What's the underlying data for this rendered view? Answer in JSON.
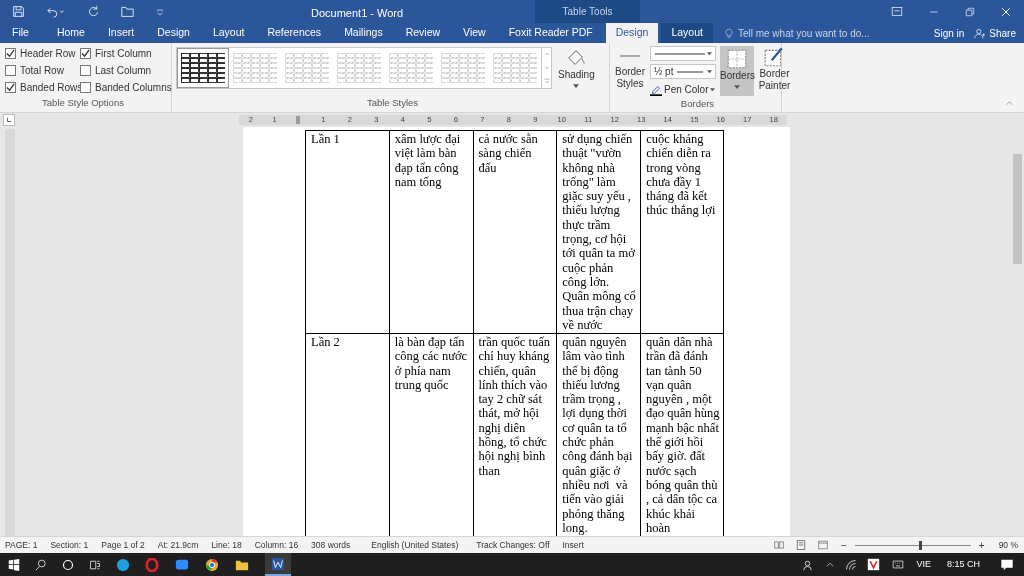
{
  "window": {
    "title": "Document1 - Word",
    "contextual_title": "Table Tools",
    "sign_in": "Sign in",
    "share": "Share"
  },
  "tabs": [
    {
      "label": "File",
      "selected": false,
      "contextual": false
    },
    {
      "label": "Home",
      "selected": false,
      "contextual": false
    },
    {
      "label": "Insert",
      "selected": false,
      "contextual": false
    },
    {
      "label": "Design",
      "selected": false,
      "contextual": false
    },
    {
      "label": "Layout",
      "selected": false,
      "contextual": false
    },
    {
      "label": "References",
      "selected": false,
      "contextual": false
    },
    {
      "label": "Mailings",
      "selected": false,
      "contextual": false
    },
    {
      "label": "Review",
      "selected": false,
      "contextual": false
    },
    {
      "label": "View",
      "selected": false,
      "contextual": false
    },
    {
      "label": "Foxit Reader PDF",
      "selected": false,
      "contextual": false
    },
    {
      "label": "Design",
      "selected": true,
      "contextual": true
    },
    {
      "label": "Layout",
      "selected": false,
      "contextual": true
    }
  ],
  "tell_me": {
    "placeholder": "Tell me what you want to do..."
  },
  "style_options": {
    "label": "Table Style Options",
    "items": [
      {
        "label": "Header Row",
        "checked": true
      },
      {
        "label": "Total Row",
        "checked": false
      },
      {
        "label": "Banded Rows",
        "checked": true
      },
      {
        "label": "First Column",
        "checked": true
      },
      {
        "label": "Last Column",
        "checked": false
      },
      {
        "label": "Banded Columns",
        "checked": false
      }
    ]
  },
  "table_styles": {
    "label": "Table Styles",
    "styles": [
      {
        "selected": true
      },
      {
        "selected": false
      },
      {
        "selected": false
      },
      {
        "selected": false
      },
      {
        "selected": false
      },
      {
        "selected": false
      },
      {
        "selected": false
      }
    ]
  },
  "shading": {
    "label": "Shading"
  },
  "borders_group": {
    "label": "Borders",
    "border_styles": "Border Styles",
    "weight": "½ pt",
    "pen_color": "Pen Color",
    "borders": {
      "label": "Borders",
      "pressed": true
    },
    "border_painter": "Border Painter"
  },
  "ruler": {
    "left_numbers": [
      "2",
      "1"
    ],
    "right_numbers": [
      "1",
      "2",
      "3",
      "4",
      "5",
      "6",
      "7",
      "8",
      "9",
      "10",
      "11",
      "12",
      "13",
      "14",
      "15",
      "16",
      "17",
      "18"
    ]
  },
  "table": {
    "rows": [
      [
        "Lần 1",
        "xâm lược đại\nviệt làm bàn\nđạp tấn công\nnam tống",
        "cả nước sẵn\nsàng chiến\nđấu",
        "sử dụng chiến\nthuật \"vườn\nkhông nhà\ntrống\" làm\ngiặc suy yếu ,\nthiếu lượng\nthực trầm\ntrọng, cơ hội\ntới quân ta mở\ncuộc phản\ncông lớn.\nQuân mông cổ\nthua trận chạy\nvề nước",
        "cuộc kháng\nchiến diễn ra\ntrong vòng\nchưa đầy 1\ntháng đã kết\nthúc thắng lợi"
      ],
      [
        "Lần 2",
        "là bàn đạp tấn\ncông các nước\nở phía nam\ntrung quốc",
        "trần quốc tuấn\nchỉ huy kháng\nchiến, quân\nlính thích vào\ntay 2 chữ sát\nthát, mở hội\nnghị diên\nhồng, tổ chức\nhội nghị bình\nthan",
        "quân nguyên\nlâm vào tình\nthế bị động\nthiếu lương\ntrầm trọng ,\nlợi dụng thời\ncơ quân ta tổ\nchức phản\ncông đánh bại\nquân giặc ở\nnhiều nơi  và\ntiến vào giải\nphóng thăng\nlong.",
        "quân dân nhà\ntrần đã đánh\ntan tành 50\nvạn quân\nnguyên , một\nđạo quân hùng\nmạnh bậc nhất\nthế giới hồi\nbấy giờ. đất\nnước sạch\nbóng quân thù\n, cả dân tộc ca\nkhúc khải\nhoàn"
      ]
    ]
  },
  "status_bar": {
    "items": [
      "PAGE: 1",
      "Section: 1",
      "Page 1 of 2",
      "At: 21.9cm",
      "Line: 18",
      "Column: 16",
      "308 words",
      "English (United States)",
      "Track Changes: Off",
      "Insert"
    ],
    "zoom": "90 %",
    "zoom_out": "−",
    "zoom_in": "+",
    "zoom_slider": {
      "level": 0.55
    }
  },
  "taskbar": {
    "language": "VIE",
    "time": "8:15 CH"
  }
}
